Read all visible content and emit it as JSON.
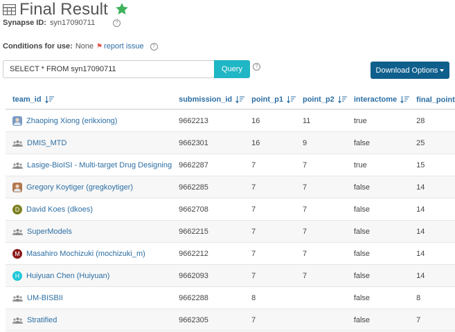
{
  "header": {
    "title": "Final Result",
    "synapse_id_label": "Synapse ID:",
    "synapse_id": "syn17090711",
    "conditions_label": "Conditions for use:",
    "conditions_value": "None",
    "report_issue": "report issue"
  },
  "query": {
    "value": "SELECT * FROM syn17090711",
    "button": "Query"
  },
  "download": {
    "label": "Download Options"
  },
  "table": {
    "columns": [
      "team_id",
      "submission_id",
      "point_p1",
      "point_p2",
      "interactome",
      "final_point"
    ],
    "rows": [
      {
        "team": "Zhaoping Xiong (erikxiong)",
        "kind": "photo",
        "color": "#7a9cc4",
        "submission_id": "9662213",
        "p1": "16",
        "p2": "11",
        "interactome": "true",
        "final": "28"
      },
      {
        "team": "DMIS_MTD",
        "kind": "team",
        "submission_id": "9662301",
        "p1": "16",
        "p2": "9",
        "interactome": "false",
        "final": "25"
      },
      {
        "team": "Lasige-BioISI - Multi-target Drug Designing",
        "kind": "team",
        "submission_id": "9662287",
        "p1": "7",
        "p2": "7",
        "interactome": "true",
        "final": "15"
      },
      {
        "team": "Gregory Koytiger (gregkoytiger)",
        "kind": "photo",
        "color": "#b07850",
        "submission_id": "9662285",
        "p1": "7",
        "p2": "7",
        "interactome": "false",
        "final": "14"
      },
      {
        "team": "David Koes (dkoes)",
        "kind": "letter",
        "letter": "D",
        "color": "#7b7f1e",
        "submission_id": "9662708",
        "p1": "7",
        "p2": "7",
        "interactome": "false",
        "final": "14"
      },
      {
        "team": "SuperModels",
        "kind": "team",
        "submission_id": "9662215",
        "p1": "7",
        "p2": "7",
        "interactome": "false",
        "final": "14"
      },
      {
        "team": "Masahiro Mochizuki (mochizuki_m)",
        "kind": "letter",
        "letter": "M",
        "color": "#8b1a1a",
        "submission_id": "9662212",
        "p1": "7",
        "p2": "7",
        "interactome": "false",
        "final": "14"
      },
      {
        "team": "Huiyuan Chen (Huiyuan)",
        "kind": "letter",
        "letter": "H",
        "color": "#20c8d8",
        "submission_id": "9662093",
        "p1": "7",
        "p2": "7",
        "interactome": "false",
        "final": "14"
      },
      {
        "team": "UM-BISBII",
        "kind": "team",
        "submission_id": "9662288",
        "p1": "8",
        "p2": "",
        "interactome": "false",
        "final": "8"
      },
      {
        "team": "Stratified",
        "kind": "team",
        "submission_id": "9662305",
        "p1": "7",
        "p2": "",
        "interactome": "false",
        "final": "7"
      }
    ]
  },
  "colors": {
    "link": "#2c6ea3",
    "query_button": "#1fb6c5",
    "download_button": "#0f5f8c",
    "star": "#3fb35a"
  }
}
